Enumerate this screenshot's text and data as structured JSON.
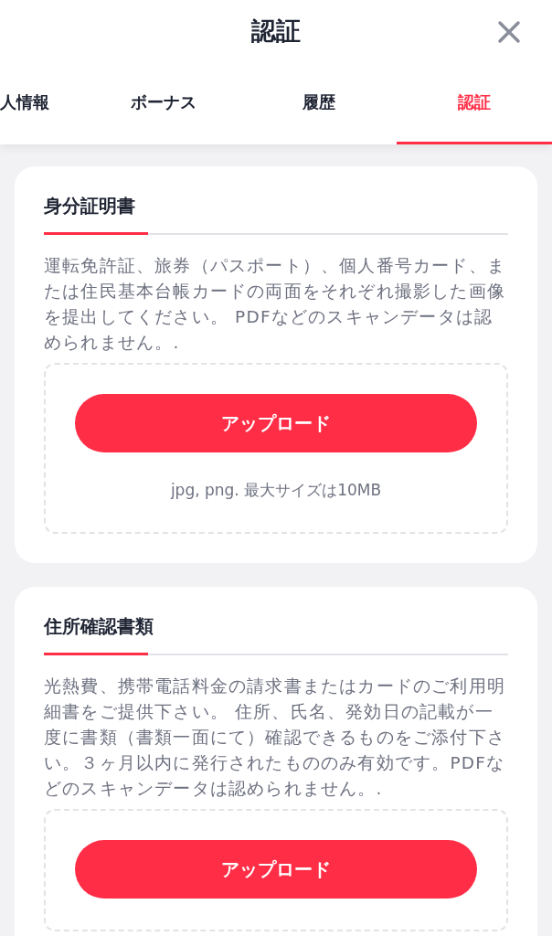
{
  "header": {
    "title": "認証"
  },
  "tabs": [
    {
      "label": "人情報",
      "selected": false
    },
    {
      "label": "ボーナス",
      "selected": false
    },
    {
      "label": "履歴",
      "selected": false
    },
    {
      "label": "認証",
      "selected": true
    }
  ],
  "sections": [
    {
      "title": "身分証明書",
      "description": "運転免許証、旅券（パスポート）、個人番号カード、または住民基本台帳カードの両面をそれぞれ撮影した画像を提出してください。 PDFなどのスキャンデータは認められません。.",
      "button": "アップロード",
      "note": "jpg, png. 最大サイズは10MB"
    },
    {
      "title": "住所確認書類",
      "description": "光熱費、携帯電話料金の請求書またはカードのご利用明細書をご提供下さい。 住所、氏名、発効日の記載が一度に書類（書類一面にて）確認できるものをご添付下さい。３ヶ月以内に発行されたもののみ有効です。PDFなどのスキャンデータは認められません。.",
      "button": "アップロード"
    }
  ]
}
